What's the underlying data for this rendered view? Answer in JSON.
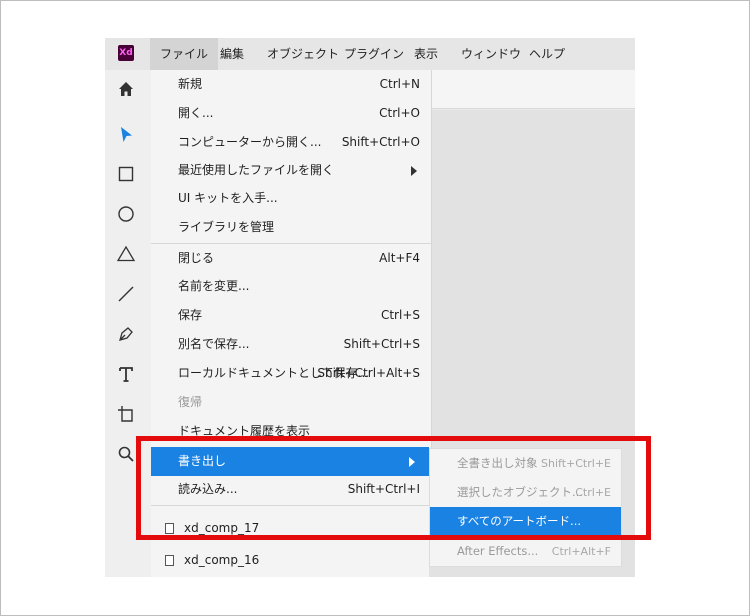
{
  "app": {
    "logo_text": "Xd"
  },
  "menubar": {
    "tabs": [
      {
        "label": "ファイル",
        "active": true
      },
      {
        "label": "編集"
      },
      {
        "label": "オブジェクト"
      },
      {
        "label": "プラグイン"
      },
      {
        "label": "表示"
      },
      {
        "label": "ウィンドウ"
      },
      {
        "label": "ヘルプ"
      }
    ]
  },
  "tools": [
    "home-icon",
    "select-arrow-icon",
    "rectangle-icon",
    "ellipse-icon",
    "triangle-icon",
    "line-icon",
    "pen-icon",
    "text-icon",
    "artboard-icon",
    "zoom-icon"
  ],
  "file_menu": {
    "items": [
      {
        "label": "新規",
        "shortcut": "Ctrl+N"
      },
      {
        "label": "開く...",
        "shortcut": "Ctrl+O"
      },
      {
        "label": "コンピューターから開く...",
        "shortcut": "Shift+Ctrl+O"
      },
      {
        "label": "最近使用したファイルを開く",
        "shortcut": ""
      },
      {
        "label": "UI キットを入手...",
        "shortcut": ""
      },
      {
        "label": "ライブラリを管理",
        "shortcut": ""
      },
      {
        "label": "閉じる",
        "shortcut": "Alt+F4"
      },
      {
        "label": "名前を変更...",
        "shortcut": ""
      },
      {
        "label": "保存",
        "shortcut": "Ctrl+S"
      },
      {
        "label": "別名で保存...",
        "shortcut": "Shift+Ctrl+S"
      },
      {
        "label": "ローカルドキュメントとして保存...",
        "shortcut": "Shift+Ctrl+Alt+S"
      },
      {
        "label": "復帰",
        "shortcut": ""
      },
      {
        "label": "ドキュメント履歴を表示",
        "shortcut": ""
      },
      {
        "label": "書き出し",
        "shortcut": ""
      },
      {
        "label": "読み込み...",
        "shortcut": "Shift+Ctrl+I"
      }
    ],
    "recent_files": [
      "xd_comp_17",
      "xd_comp_16"
    ]
  },
  "export_submenu": {
    "items": [
      {
        "label": "全書き出し対象",
        "shortcut": "Shift+Ctrl+E"
      },
      {
        "label": "選択したオブジェクト...",
        "shortcut": "Ctrl+E"
      },
      {
        "label": "すべてのアートボード...",
        "shortcut": ""
      },
      {
        "label": "After Effects...",
        "shortcut": "Ctrl+Alt+F"
      }
    ]
  },
  "colors": {
    "highlight": "#1a82e2",
    "annotation_box": "#e30b0b",
    "xd_brand": "#470137"
  }
}
